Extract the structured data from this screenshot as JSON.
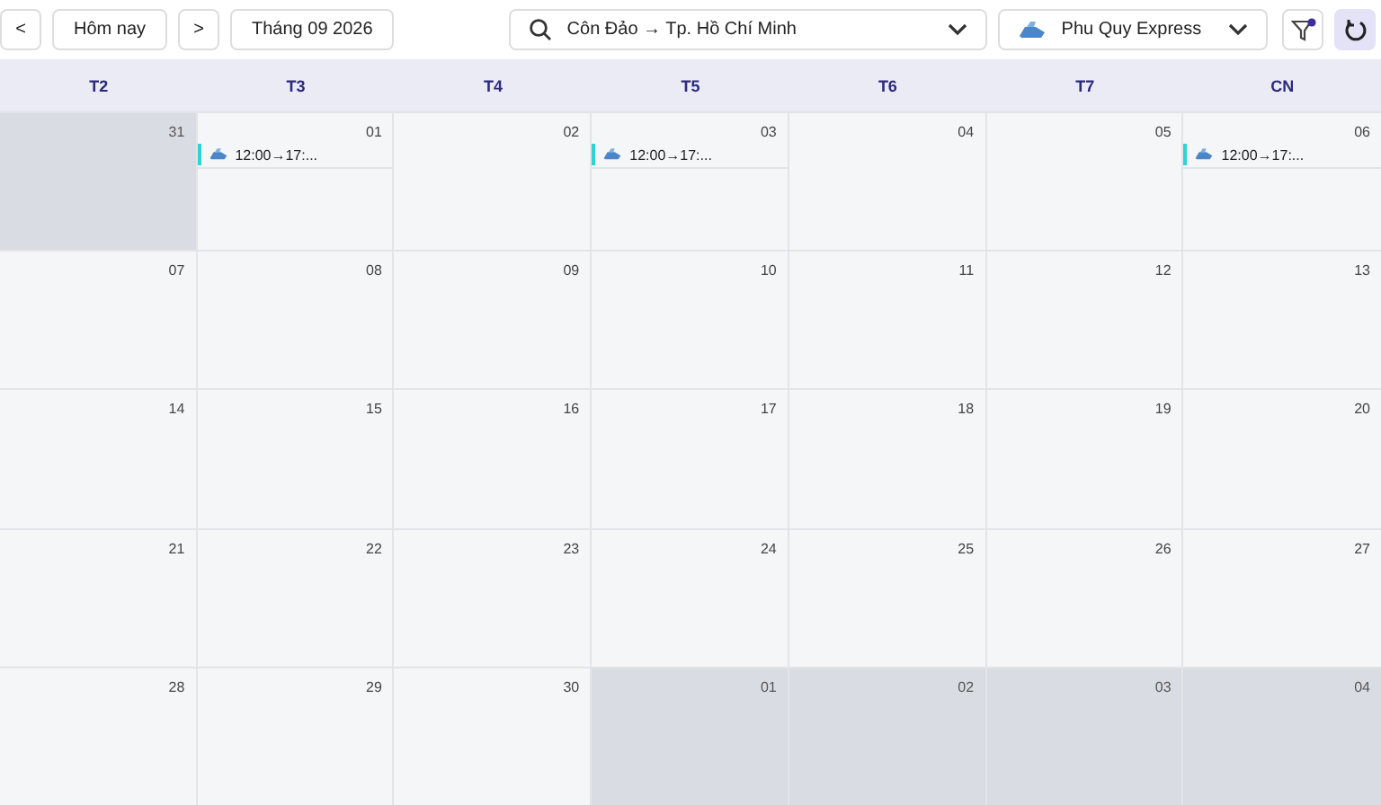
{
  "toolbar": {
    "prev": "<",
    "today": "Hôm nay",
    "next": ">",
    "month": "Tháng 09 2026",
    "route": "Côn Đảo → Tp. Hồ Chí Minh",
    "operator": "Phu Quy Express",
    "filter_active": true
  },
  "weekdays": [
    "T2",
    "T3",
    "T4",
    "T5",
    "T6",
    "T7",
    "CN"
  ],
  "weeks": [
    [
      {
        "label": "31",
        "outside": true
      },
      {
        "label": "01",
        "outside": false,
        "events": [
          {
            "text": "12:00→17:...",
            "color": "#2dd4d4"
          }
        ]
      },
      {
        "label": "02",
        "outside": false
      },
      {
        "label": "03",
        "outside": false,
        "events": [
          {
            "text": "12:00→17:...",
            "color": "#2dd4d4"
          }
        ]
      },
      {
        "label": "04",
        "outside": false
      },
      {
        "label": "05",
        "outside": false
      },
      {
        "label": "06",
        "outside": false,
        "events": [
          {
            "text": "12:00→17:...",
            "color": "#2dd4d4"
          }
        ]
      }
    ],
    [
      {
        "label": "07",
        "outside": false
      },
      {
        "label": "08",
        "outside": false
      },
      {
        "label": "09",
        "outside": false
      },
      {
        "label": "10",
        "outside": false
      },
      {
        "label": "11",
        "outside": false
      },
      {
        "label": "12",
        "outside": false
      },
      {
        "label": "13",
        "outside": false
      }
    ],
    [
      {
        "label": "14",
        "outside": false
      },
      {
        "label": "15",
        "outside": false
      },
      {
        "label": "16",
        "outside": false
      },
      {
        "label": "17",
        "outside": false
      },
      {
        "label": "18",
        "outside": false
      },
      {
        "label": "19",
        "outside": false
      },
      {
        "label": "20",
        "outside": false
      }
    ],
    [
      {
        "label": "21",
        "outside": false
      },
      {
        "label": "22",
        "outside": false
      },
      {
        "label": "23",
        "outside": false
      },
      {
        "label": "24",
        "outside": false
      },
      {
        "label": "25",
        "outside": false
      },
      {
        "label": "26",
        "outside": false
      },
      {
        "label": "27",
        "outside": false
      }
    ],
    [
      {
        "label": "28",
        "outside": false
      },
      {
        "label": "29",
        "outside": false
      },
      {
        "label": "30",
        "outside": false
      },
      {
        "label": "01",
        "outside": true
      },
      {
        "label": "02",
        "outside": true
      },
      {
        "label": "03",
        "outside": true
      },
      {
        "label": "04",
        "outside": true
      }
    ]
  ]
}
